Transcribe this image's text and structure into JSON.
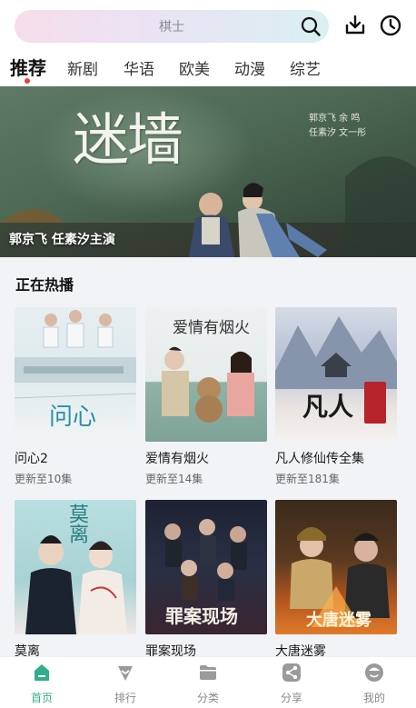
{
  "search": {
    "placeholder": "棋士"
  },
  "tabs": [
    {
      "label": "推荐",
      "active": true
    },
    {
      "label": "新剧"
    },
    {
      "label": "华语"
    },
    {
      "label": "欧美"
    },
    {
      "label": "动漫"
    },
    {
      "label": "综艺"
    }
  ],
  "banner": {
    "poster_title": "迷墙",
    "credits_line1": "郭京飞 余 鸣",
    "credits_line2": "任素汐 文一彤",
    "caption": "郭京飞 任素汐主演"
  },
  "section": {
    "title": "正在热播"
  },
  "shows": [
    {
      "title": "问心2",
      "status": "更新至10集",
      "poster_text": "问心"
    },
    {
      "title": "爱情有烟火",
      "status": "更新至14集",
      "poster_text": "爱情有烟火"
    },
    {
      "title": "凡人修仙传全集",
      "status": "更新至181集",
      "poster_text": "凡人"
    },
    {
      "title": "莫离",
      "poster_text": "莫离"
    },
    {
      "title": "罪案现场",
      "poster_text": "罪案现场"
    },
    {
      "title": "大唐迷雾",
      "poster_text": "大唐迷雾"
    }
  ],
  "nav": [
    {
      "label": "首页",
      "icon": "home-icon",
      "active": true
    },
    {
      "label": "排行",
      "icon": "ranking-icon"
    },
    {
      "label": "分类",
      "icon": "folder-icon"
    },
    {
      "label": "分享",
      "icon": "share-icon"
    },
    {
      "label": "我的",
      "icon": "profile-icon"
    }
  ],
  "colors": {
    "accent": "#2fae8f",
    "tab_dot": "#ef3b3b",
    "icon_inactive": "#9a9a9a"
  }
}
